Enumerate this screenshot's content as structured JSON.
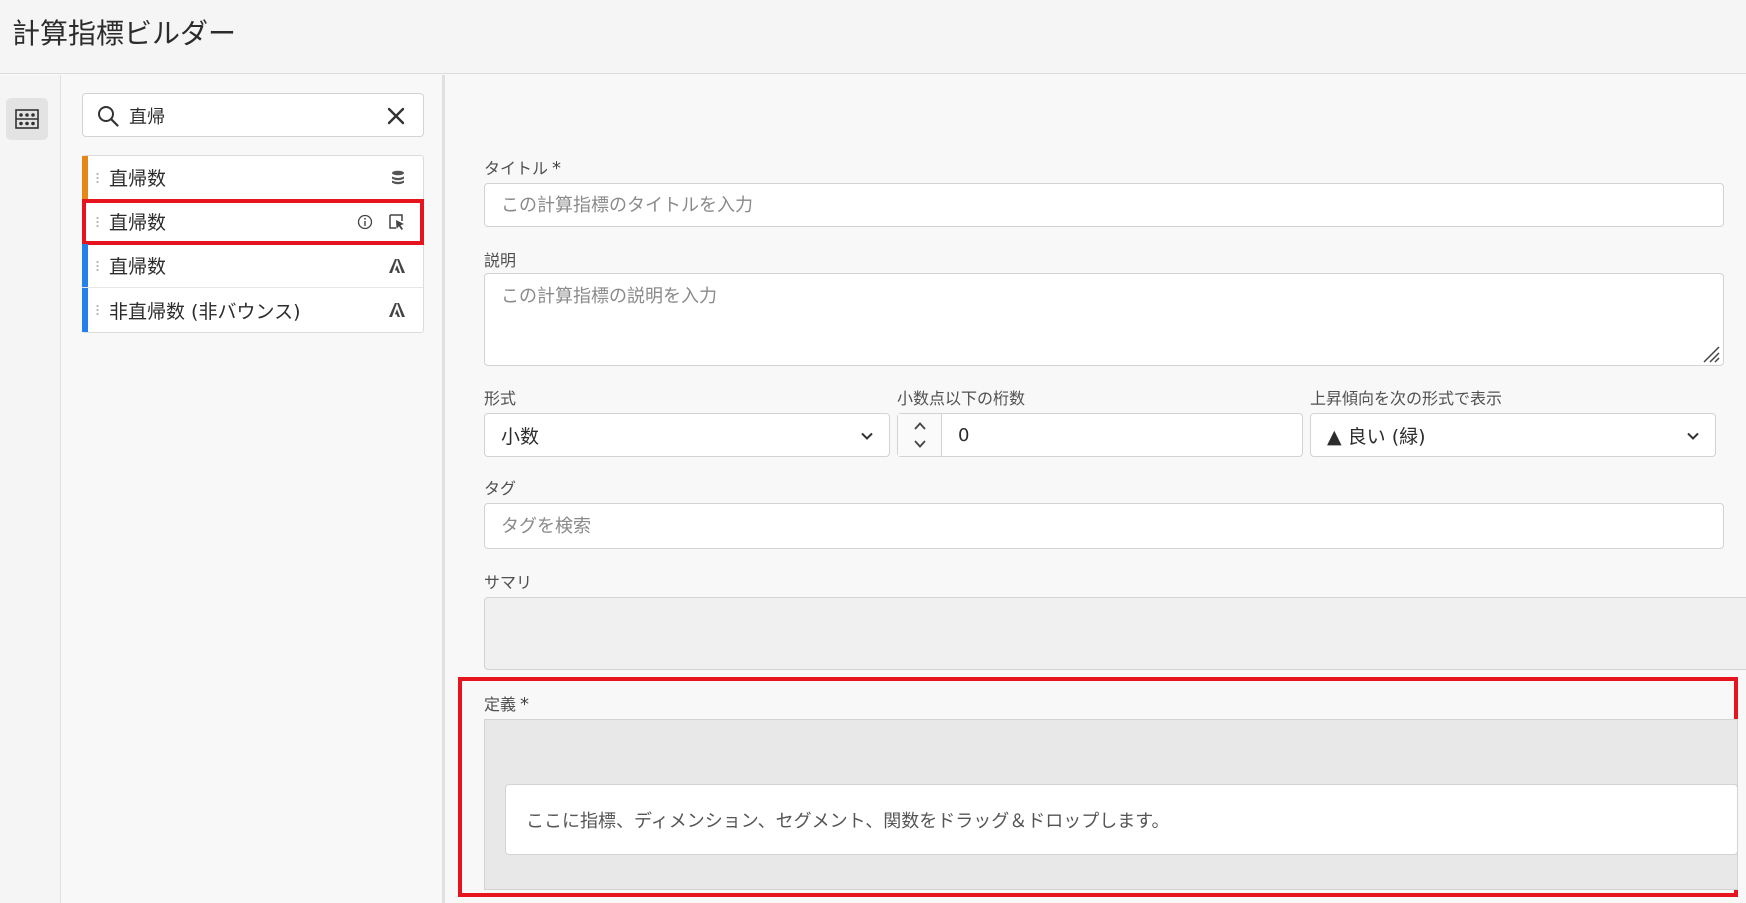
{
  "app": {
    "title": "計算指標ビルダー"
  },
  "rail": {
    "items": [
      {
        "icon": "components-panel-icon"
      }
    ]
  },
  "search": {
    "value": "直帰",
    "icon": "search-icon",
    "clear_icon": "close-icon"
  },
  "components": [
    {
      "label": "直帰数",
      "color": "#e68619",
      "icon": "stack-icon",
      "selected": false,
      "has_info": false
    },
    {
      "label": "直帰数",
      "color": "#e5141e",
      "icon": "calculated-metric-icon",
      "selected": true,
      "has_info": true
    },
    {
      "label": "直帰数",
      "color": "#2680eb",
      "icon": "adobe-icon",
      "selected": false,
      "has_info": false
    },
    {
      "label": "非直帰数 (非バウンス)",
      "color": "#2680eb",
      "icon": "adobe-icon",
      "selected": false,
      "has_info": false
    }
  ],
  "form": {
    "title_label": "タイトル",
    "required_mark": "*",
    "title_placeholder": "この計算指標のタイトルを入力",
    "description_label": "説明",
    "description_placeholder": "この計算指標の説明を入力",
    "format_label": "形式",
    "format_value": "小数",
    "decimals_label": "小数点以下の桁数",
    "decimals_value": "0",
    "trend_label": "上昇傾向を次の形式で表示",
    "trend_value": "▲ 良い (緑)",
    "tags_label": "タグ",
    "tags_placeholder": "タグを検索",
    "summary_label": "サマリ",
    "definition_label": "定義",
    "definition_dropzone": "ここに指標、ディメンション、セグメント、関数をドラッグ＆ドロップします。"
  },
  "colors": {
    "highlight": "#e5141e",
    "orange": "#e68619",
    "blue": "#2680eb"
  }
}
